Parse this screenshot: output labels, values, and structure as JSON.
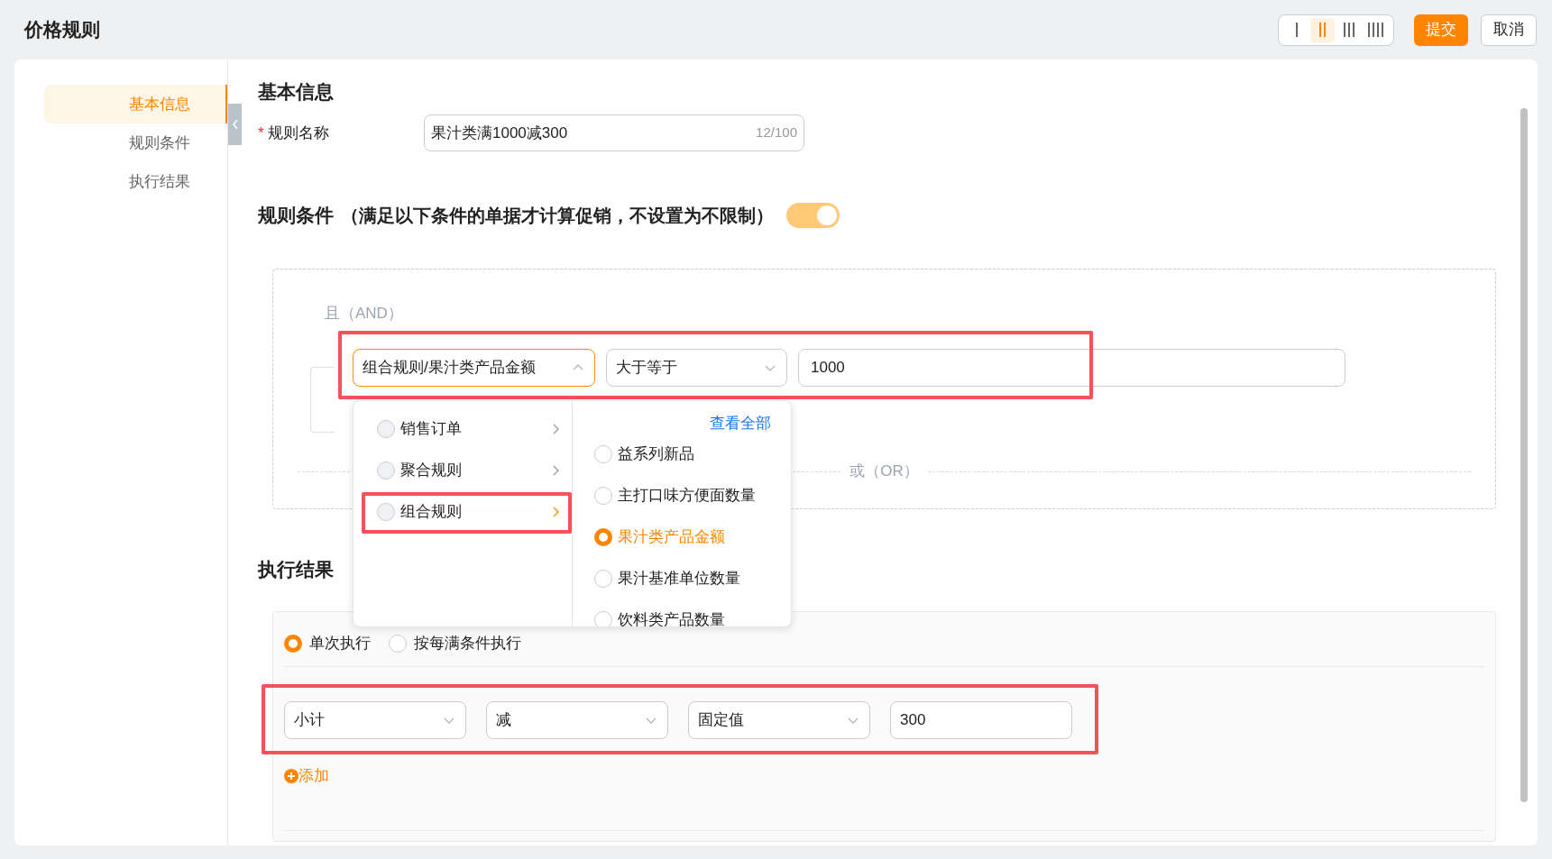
{
  "header": {
    "title": "价格规则",
    "column_options": [
      {
        "selected": false
      },
      {
        "selected": true
      },
      {
        "selected": false
      },
      {
        "selected": false
      }
    ],
    "buttons": [
      {
        "label": "提交",
        "kind": "primary"
      },
      {
        "label": "取消",
        "kind": "default"
      }
    ]
  },
  "sidebar": {
    "items": [
      {
        "label": "基本信息",
        "selected": true
      },
      {
        "label": "规则条件",
        "selected": false
      },
      {
        "label": "执行结果",
        "selected": false
      }
    ]
  },
  "basic_info": {
    "heading": "基本信息",
    "field": {
      "label": "规则名称",
      "required_mark": "*",
      "value": "果汁类满1000减300",
      "counter": "12/100"
    }
  },
  "conditions": {
    "heading": "规则条件",
    "note": "（满足以下条件的单据才计算促销，不设置为不限制）",
    "enabled": true,
    "and_label": "且（AND）",
    "or_label": "或（OR）",
    "row": {
      "highlighted": true,
      "field": {
        "value": "组合规则/果汁类产品金额",
        "open": true
      },
      "operator": "大于等于",
      "value": "1000"
    },
    "dropdown": {
      "view_all": "查看全部",
      "categories": [
        {
          "label": "销售订单",
          "selected": false,
          "highlighted": false
        },
        {
          "label": "聚合规则",
          "selected": false,
          "highlighted": false
        },
        {
          "label": "组合规则",
          "selected": true,
          "highlighted": true
        }
      ],
      "options": [
        {
          "label": "益系列新品",
          "selected": false
        },
        {
          "label": "主打口味方便面数量",
          "selected": false
        },
        {
          "label": "果汁类产品金额",
          "selected": true
        },
        {
          "label": "果汁基准单位数量",
          "selected": false
        },
        {
          "label": "饮料类产品数量",
          "selected": false
        }
      ]
    }
  },
  "results": {
    "heading": "执行结果",
    "modes": [
      {
        "label": "单次执行",
        "selected": true
      },
      {
        "label": "按每满条件执行",
        "selected": false
      }
    ],
    "row": {
      "highlighted": true,
      "selects": [
        "小计",
        "减",
        "固定值"
      ],
      "value": "300"
    },
    "add_label": "添加"
  }
}
